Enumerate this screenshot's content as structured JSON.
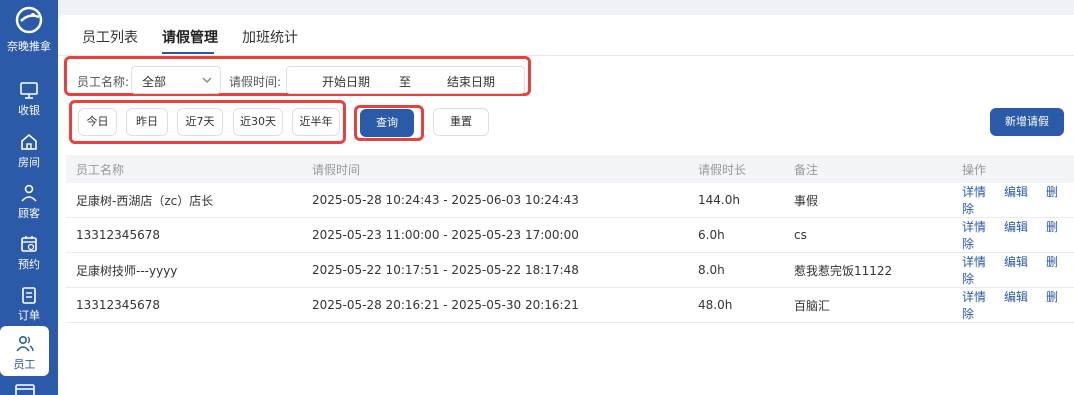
{
  "sidebar": {
    "brand": "奈晚推拿",
    "items": [
      {
        "label": "收银",
        "icon": "cashier-icon"
      },
      {
        "label": "房间",
        "icon": "home-icon"
      },
      {
        "label": "顾客",
        "icon": "user-icon"
      },
      {
        "label": "预约",
        "icon": "calendar-icon"
      },
      {
        "label": "订单",
        "icon": "order-icon"
      },
      {
        "label": "员工",
        "icon": "staff-icon",
        "active": true
      }
    ]
  },
  "tabs": [
    "员工列表",
    "请假管理",
    "加班统计"
  ],
  "filters": {
    "employee_label": "员工名称:",
    "employee_value": "全部",
    "leave_time_label": "请假时间:",
    "start_placeholder": "开始日期",
    "range_sep": "至",
    "end_placeholder": "结束日期"
  },
  "quick_ranges": [
    "今日",
    "昨日",
    "近7天",
    "近30天",
    "近半年"
  ],
  "buttons": {
    "search": "查询",
    "reset": "重置",
    "add": "新增请假"
  },
  "table": {
    "headers": [
      "员工名称",
      "请假时间",
      "请假时长",
      "备注",
      "操作"
    ],
    "actions": [
      "详情",
      "编辑",
      "删除"
    ],
    "rows": [
      [
        "足康树-西湖店（zc）店长",
        "2025-05-28 10:24:43 - 2025-06-03 10:24:43",
        "144.0h",
        "事假"
      ],
      [
        "13312345678",
        "2025-05-23 11:00:00 - 2025-05-23 17:00:00",
        "6.0h",
        "cs"
      ],
      [
        "足康树技师---yyyy",
        "2025-05-22 10:17:51 - 2025-05-22 18:17:48",
        "8.0h",
        "惹我惹完饭11122"
      ],
      [
        "13312345678",
        "2025-05-28 20:16:21 - 2025-05-30 20:16:21",
        "48.0h",
        "百脑汇"
      ]
    ]
  },
  "colors": {
    "primary": "#2b5aa8",
    "highlight": "#e8413c"
  }
}
